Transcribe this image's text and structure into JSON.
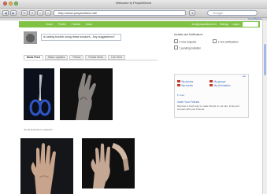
{
  "window": {
    "title": "Welcome to PeopleDirect"
  },
  "browser": {
    "url": "http://www.peopledirect.net/",
    "search_placeholder": "Google",
    "top_right_link": "Scroll Bottom"
  },
  "site_nav": {
    "links": [
      "Home",
      "Profile",
      "Friends",
      "Inbox"
    ],
    "right_links": [
      "info@peopledirect.net",
      "Settings",
      "Logout"
    ]
  },
  "status": {
    "text": "is having trouble using these scissors - Any suggestions?"
  },
  "tabs": [
    "News Feed",
    "Status Updates",
    "Photos",
    "Posted Items",
    "Live Feed"
  ],
  "feed": {
    "caption": "Jonna Robinson's snapshot"
  },
  "updates": {
    "title": "Updates and Notifications",
    "items": [
      "3 new requests",
      "2 new notifications",
      "1 pending invitation"
    ]
  },
  "profile_panel": {
    "edit_label": "edit",
    "links": [
      "My photos",
      "My events",
      "My groups",
      "My information"
    ],
    "more_label": "▾ more",
    "invite_title": "Invite Your Friends",
    "invite_text": "Discover a fresh way to make friends on our site. Invite and connect with your Friends."
  },
  "colors": {
    "nav_green": "#7fc142",
    "link_blue": "#3a66b3"
  }
}
